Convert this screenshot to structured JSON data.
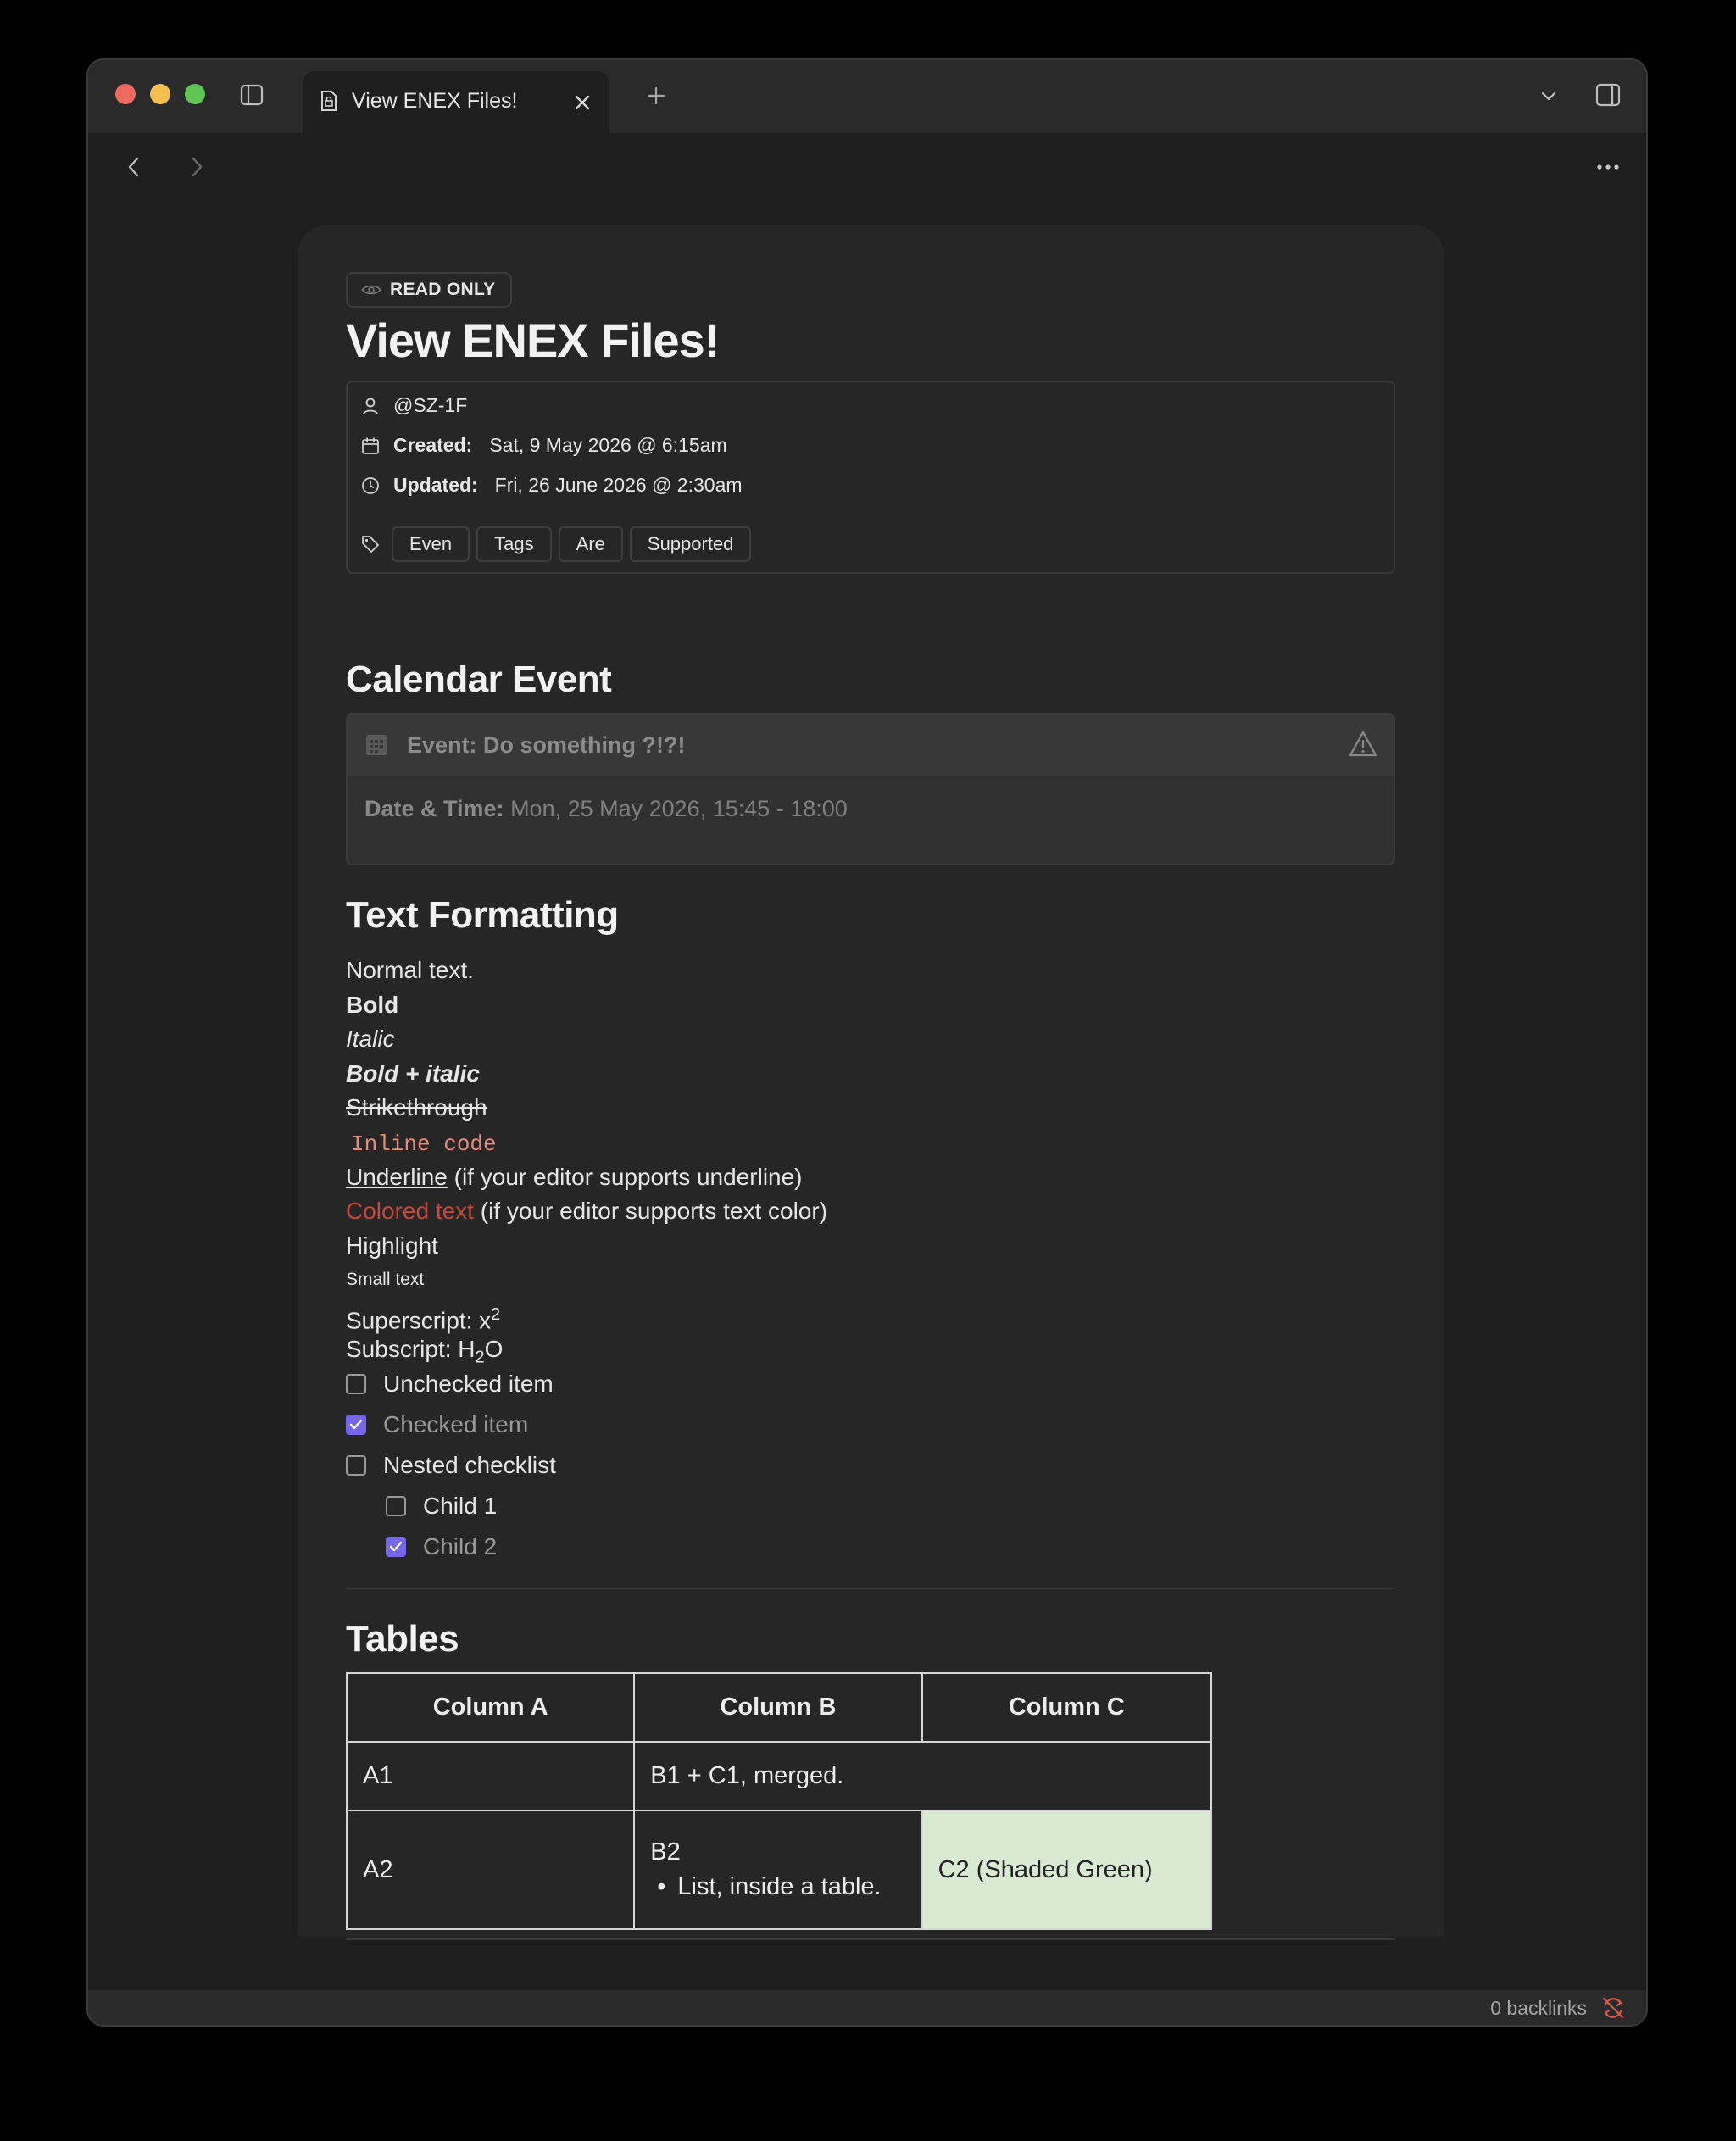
{
  "tab": {
    "title": "View ENEX Files!"
  },
  "badge": {
    "label": "READ ONLY"
  },
  "document": {
    "title": "View ENEX Files!"
  },
  "metadata": {
    "author": "@SZ-1F",
    "created_label": "Created:",
    "created_value": "Sat, 9 May 2026 @ 6:15am",
    "updated_label": "Updated:",
    "updated_value": "Fri, 26 June 2026 @ 2:30am",
    "tags": [
      "Even",
      "Tags",
      "Are",
      "Supported"
    ]
  },
  "calendar": {
    "heading": "Calendar Event",
    "event_title": "Event: Do something ?!?!",
    "datetime_label": "Date & Time:",
    "datetime_value": "Mon, 25 May 2026, 15:45 - 18:00"
  },
  "formatting": {
    "heading": "Text Formatting",
    "normal": "Normal text.",
    "bold": "Bold",
    "italic": "Italic",
    "bold_italic": "Bold + italic",
    "strikethrough": "Strikethrough",
    "inline_code": "Inline code",
    "underline": "Underline",
    "underline_note": "(if your editor supports underline)",
    "colored": "Colored text",
    "colored_note": "(if your editor supports text color)",
    "highlight": "Highlight",
    "small": "Small text",
    "superscript_label": "Superscript: x",
    "superscript_value": "2",
    "subscript_label": "Subscript: H",
    "subscript_value": "2",
    "subscript_tail": "O"
  },
  "checklist": [
    {
      "label": "Unchecked item",
      "checked": false,
      "level": 0
    },
    {
      "label": "Checked item",
      "checked": true,
      "level": 0
    },
    {
      "label": "Nested checklist",
      "checked": false,
      "level": 0
    },
    {
      "label": "Child 1",
      "checked": false,
      "level": 1
    },
    {
      "label": "Child 2",
      "checked": true,
      "level": 1
    }
  ],
  "tables": {
    "heading": "Tables",
    "headers": [
      "Column A",
      "Column B",
      "Column C"
    ],
    "row1": {
      "a": "A1",
      "bc_merged": "B1 + C1, merged."
    },
    "row2": {
      "a": "A2",
      "b": "B2",
      "b_list_item": "List, inside a table.",
      "c": "C2 (Shaded Green)"
    },
    "shade_color": "#d9ead3"
  },
  "colors": {
    "checkbox_accent": "#7468e8",
    "colored_text": "#c4493a",
    "inline_code": "#e08f7a"
  },
  "statusbar": {
    "backlinks": "0 backlinks"
  }
}
